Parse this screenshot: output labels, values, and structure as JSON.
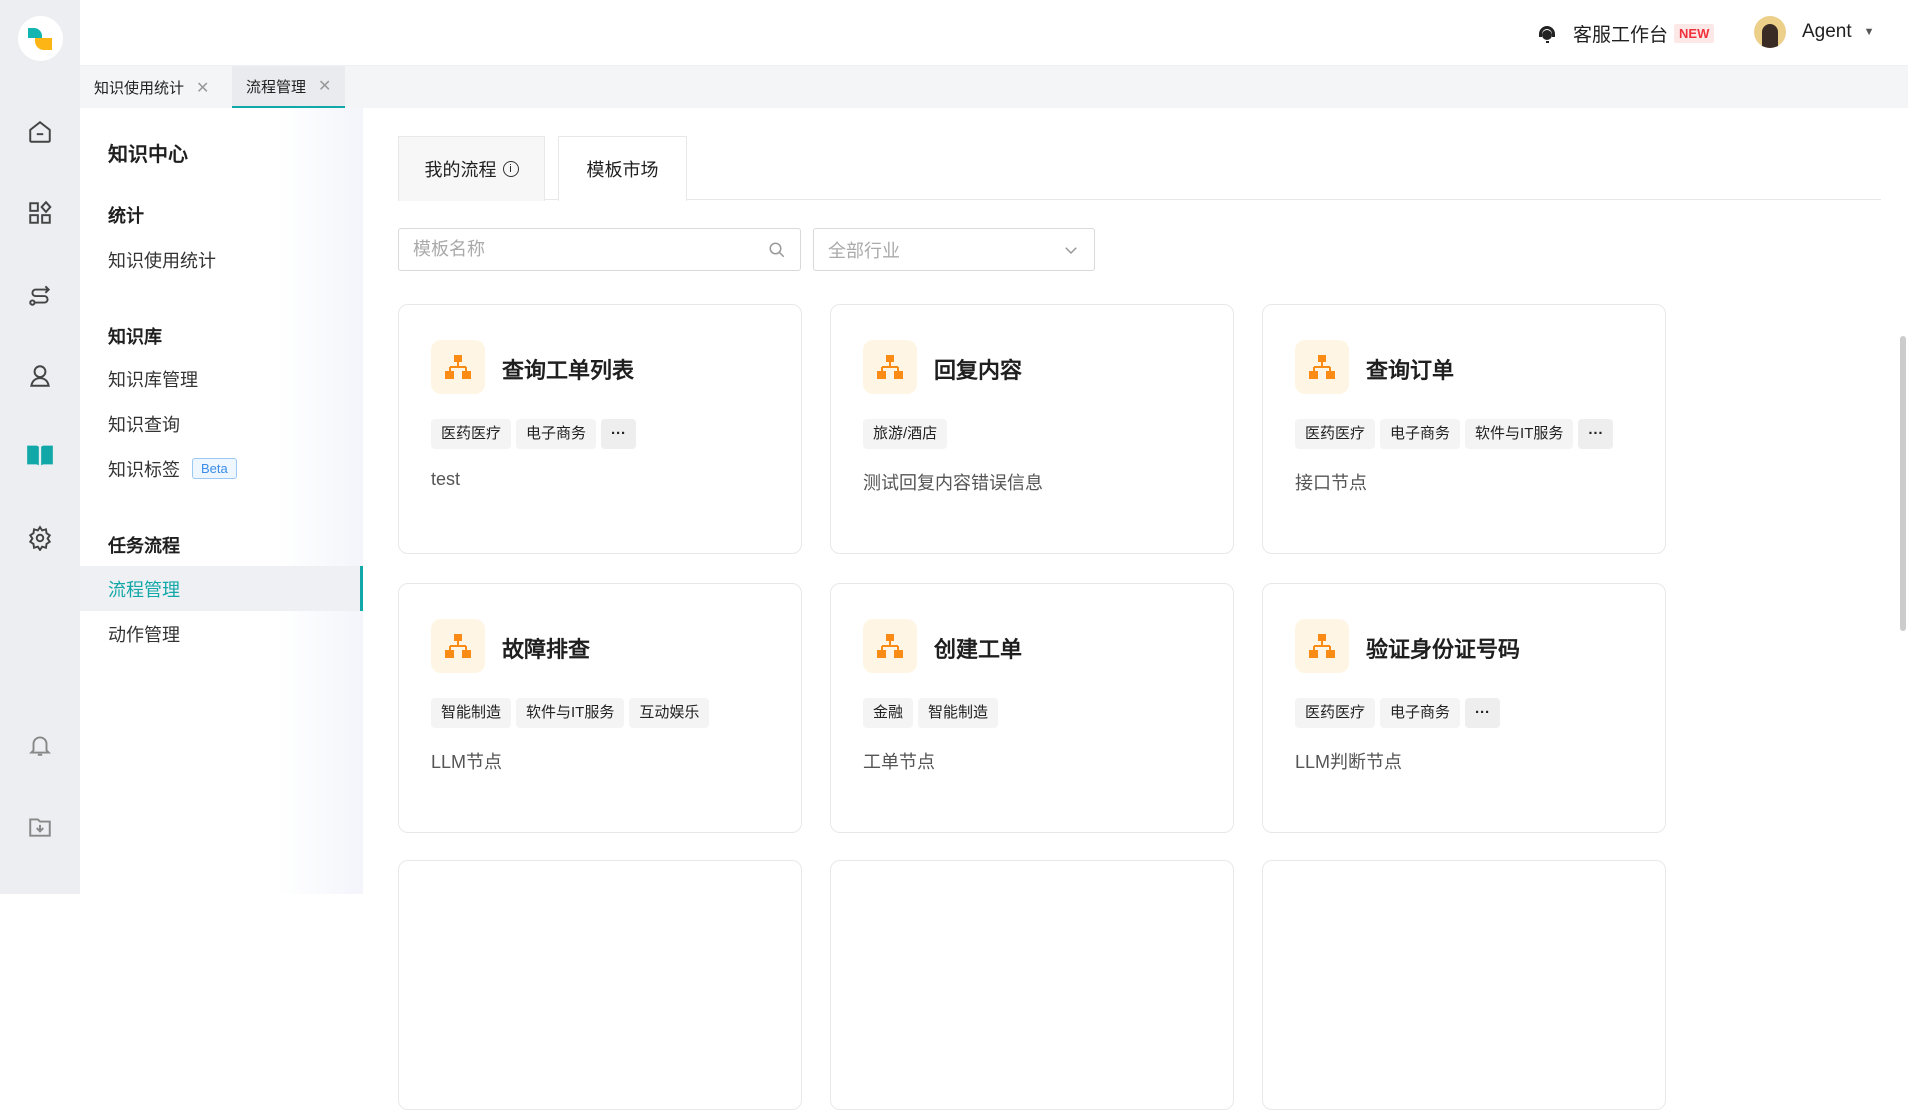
{
  "header": {
    "workbench": "客服工作台",
    "new_badge": "NEW",
    "user": "Agent"
  },
  "page_tabs": [
    {
      "label": "知识使用统计"
    },
    {
      "label": "流程管理"
    }
  ],
  "nav": {
    "title": "知识中心",
    "groups": [
      {
        "label": "统计",
        "items": [
          "知识使用统计"
        ]
      },
      {
        "label": "知识库",
        "items": [
          "知识库管理",
          "知识查询",
          "知识标签"
        ]
      },
      {
        "label": "任务流程",
        "items": [
          "流程管理",
          "动作管理"
        ]
      }
    ],
    "beta": "Beta",
    "active": "流程管理"
  },
  "main": {
    "tabs": [
      "我的流程",
      "模板市场"
    ],
    "active_tab": "模板市场",
    "search_placeholder": "模板名称",
    "industry_placeholder": "全部行业",
    "cards": [
      {
        "title": "查询工单列表",
        "tags": [
          "医药医疗",
          "电子商务"
        ],
        "more": true,
        "desc": "test"
      },
      {
        "title": "回复内容",
        "tags": [
          "旅游/酒店"
        ],
        "more": false,
        "desc": "测试回复内容错误信息"
      },
      {
        "title": "查询订单",
        "tags": [
          "医药医疗",
          "电子商务",
          "软件与IT服务"
        ],
        "more": true,
        "desc": "接口节点"
      },
      {
        "title": "故障排查",
        "tags": [
          "智能制造",
          "软件与IT服务",
          "互动娱乐"
        ],
        "more": false,
        "desc": "LLM节点"
      },
      {
        "title": "创建工单",
        "tags": [
          "金融",
          "智能制造"
        ],
        "more": false,
        "desc": "工单节点"
      },
      {
        "title": "验证身份证号码",
        "tags": [
          "医药医疗",
          "电子商务"
        ],
        "more": true,
        "desc": "LLM判断节点"
      }
    ]
  },
  "colors": {
    "accent": "#13a8a8",
    "icon_orange": "#fa8c16",
    "new_red": "#f0323c"
  }
}
